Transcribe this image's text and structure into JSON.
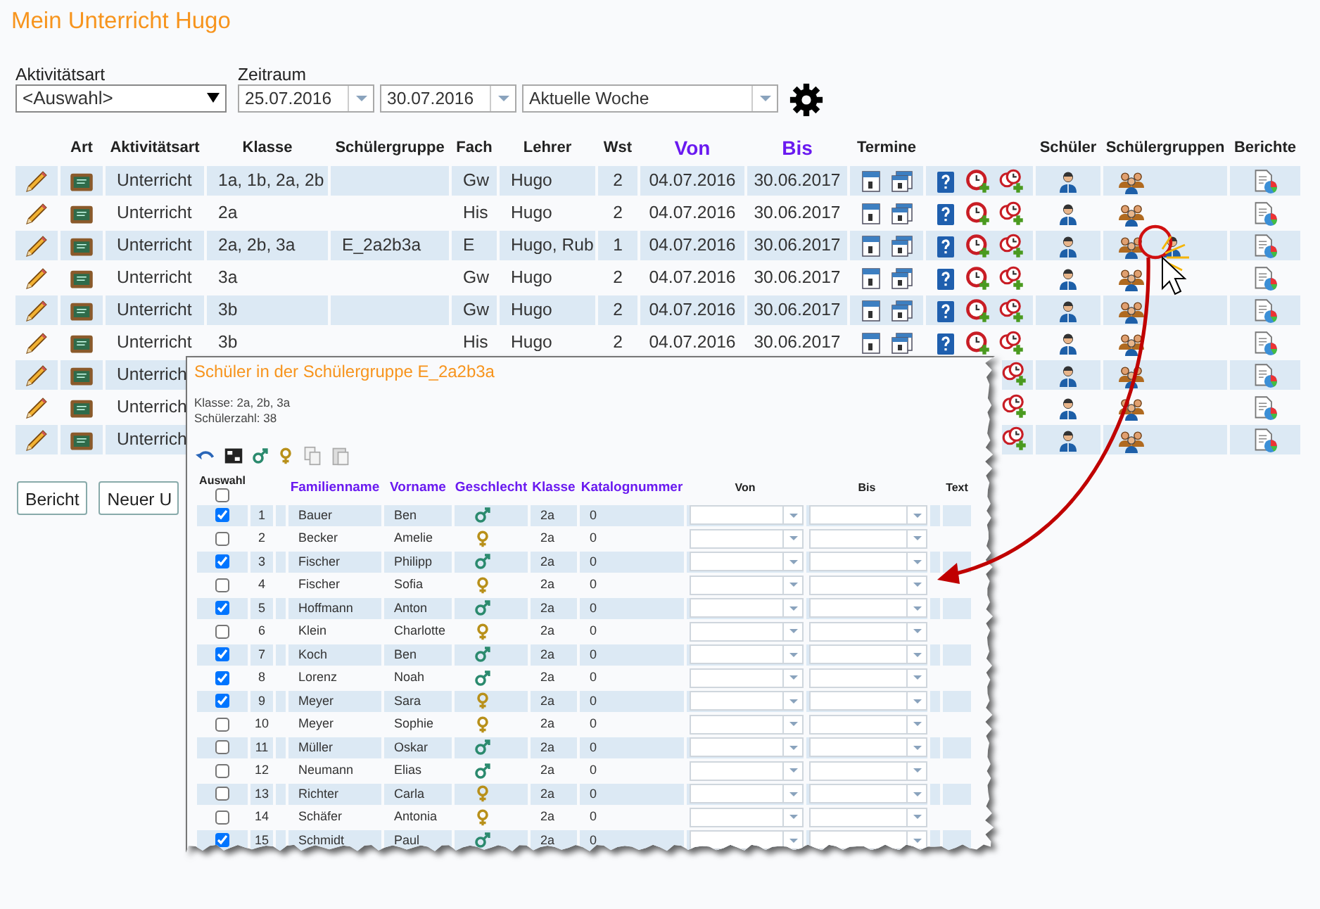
{
  "page_title": "Mein Unterricht Hugo",
  "filters": {
    "aktivitaetsart": {
      "label": "Aktivitätsart",
      "value": "<Auswahl>"
    },
    "zeitraum": {
      "label": "Zeitraum",
      "from": "25.07.2016",
      "to": "30.07.2016",
      "preset": "Aktuelle Woche"
    }
  },
  "table": {
    "columns": [
      {
        "label": "Art",
        "sortable": false
      },
      {
        "label": "Aktivitätsart",
        "sortable": false
      },
      {
        "label": "Klasse",
        "sortable": false
      },
      {
        "label": "Schülergruppe",
        "sortable": false
      },
      {
        "label": "Fach",
        "sortable": false
      },
      {
        "label": "Lehrer",
        "sortable": false
      },
      {
        "label": "Wst",
        "sortable": false
      },
      {
        "label": "Von",
        "sortable": true
      },
      {
        "label": "Bis",
        "sortable": true
      },
      {
        "label": "Termine",
        "sortable": false
      },
      {
        "label": "Schüler",
        "sortable": false
      },
      {
        "label": "Schülergruppen",
        "sortable": false
      },
      {
        "label": "Berichte",
        "sortable": false
      }
    ],
    "rows": [
      {
        "aktivitaetsart": "Unterricht",
        "klasse": "1a, 1b, 2a, 2b",
        "schuelergruppe": "",
        "fach": "Gw",
        "lehrer": "Hugo",
        "wst": "2",
        "von": "04.07.2016",
        "bis": "30.06.2017",
        "covered": false,
        "group_member": false,
        "callout": false
      },
      {
        "aktivitaetsart": "Unterricht",
        "klasse": "2a",
        "schuelergruppe": "",
        "fach": "His",
        "lehrer": "Hugo",
        "wst": "2",
        "von": "04.07.2016",
        "bis": "30.06.2017",
        "covered": false,
        "group_member": false,
        "callout": false
      },
      {
        "aktivitaetsart": "Unterricht",
        "klasse": "2a, 2b, 3a",
        "schuelergruppe": "E_2a2b3a",
        "fach": "E",
        "lehrer": "Hugo, Rub",
        "wst": "1",
        "von": "04.07.2016",
        "bis": "30.06.2017",
        "covered": false,
        "group_member": true,
        "callout": true
      },
      {
        "aktivitaetsart": "Unterricht",
        "klasse": "3a",
        "schuelergruppe": "",
        "fach": "Gw",
        "lehrer": "Hugo",
        "wst": "2",
        "von": "04.07.2016",
        "bis": "30.06.2017",
        "covered": false,
        "group_member": false,
        "callout": false
      },
      {
        "aktivitaetsart": "Unterricht",
        "klasse": "3b",
        "schuelergruppe": "",
        "fach": "Gw",
        "lehrer": "Hugo",
        "wst": "2",
        "von": "04.07.2016",
        "bis": "30.06.2017",
        "covered": false,
        "group_member": false,
        "callout": false
      },
      {
        "aktivitaetsart": "Unterricht",
        "klasse": "3b",
        "schuelergruppe": "",
        "fach": "His",
        "lehrer": "Hugo",
        "wst": "2",
        "von": "04.07.2016",
        "bis": "30.06.2017",
        "covered": false,
        "group_member": false,
        "callout": false
      },
      {
        "aktivitaetsart": "Unterrich",
        "covered": true,
        "group_member": false,
        "callout": false
      },
      {
        "aktivitaetsart": "Unterrich",
        "covered": true,
        "group_member": false,
        "callout": false
      },
      {
        "aktivitaetsart": "Unterrich",
        "covered": true,
        "group_member": false,
        "callout": false
      }
    ]
  },
  "buttons": [
    "Bericht",
    "Neuer U"
  ],
  "popup": {
    "title": "Schüler in der Schülergruppe E_2a2b3a",
    "info": [
      "Klasse: 2a, 2b, 3a",
      "Schülerzahl: 38"
    ],
    "select_all": {
      "label": "Auswahl",
      "checked": false
    },
    "columns": [
      {
        "label": "Familienname",
        "sortable": true
      },
      {
        "label": "Vorname",
        "sortable": true
      },
      {
        "label": "Geschlecht",
        "sortable": true
      },
      {
        "label": "Klasse",
        "sortable": true
      },
      {
        "label": "Katalognummer",
        "sortable": true
      },
      {
        "label": "Von",
        "sortable": false
      },
      {
        "label": "Bis",
        "sortable": false
      },
      {
        "label": "Text",
        "sortable": false
      }
    ],
    "rows": [
      {
        "checked": true,
        "nr": "1",
        "familienname": "Bauer",
        "vorname": "Ben",
        "kind": "male",
        "klasse": "2a",
        "katalognummer": "0"
      },
      {
        "checked": false,
        "nr": "2",
        "familienname": "Becker",
        "vorname": "Amelie",
        "kind": "female",
        "klasse": "2a",
        "katalognummer": "0"
      },
      {
        "checked": true,
        "nr": "3",
        "familienname": "Fischer",
        "vorname": "Philipp",
        "kind": "male",
        "klasse": "2a",
        "katalognummer": "0"
      },
      {
        "checked": false,
        "nr": "4",
        "familienname": "Fischer",
        "vorname": "Sofia",
        "kind": "female",
        "klasse": "2a",
        "katalognummer": "0"
      },
      {
        "checked": true,
        "nr": "5",
        "familienname": "Hoffmann",
        "vorname": "Anton",
        "kind": "male",
        "klasse": "2a",
        "katalognummer": "0"
      },
      {
        "checked": false,
        "nr": "6",
        "familienname": "Klein",
        "vorname": "Charlotte",
        "kind": "female",
        "klasse": "2a",
        "katalognummer": "0"
      },
      {
        "checked": true,
        "nr": "7",
        "familienname": "Koch",
        "vorname": "Ben",
        "kind": "male",
        "klasse": "2a",
        "katalognummer": "0"
      },
      {
        "checked": true,
        "nr": "8",
        "familienname": "Lorenz",
        "vorname": "Noah",
        "kind": "male",
        "klasse": "2a",
        "katalognummer": "0"
      },
      {
        "checked": true,
        "nr": "9",
        "familienname": "Meyer",
        "vorname": "Sara",
        "kind": "female",
        "klasse": "2a",
        "katalognummer": "0"
      },
      {
        "checked": false,
        "nr": "10",
        "familienname": "Meyer",
        "vorname": "Sophie",
        "kind": "female",
        "klasse": "2a",
        "katalognummer": "0"
      },
      {
        "checked": false,
        "nr": "11",
        "familienname": "Müller",
        "vorname": "Oskar",
        "kind": "male",
        "klasse": "2a",
        "katalognummer": "0"
      },
      {
        "checked": false,
        "nr": "12",
        "familienname": "Neumann",
        "vorname": "Elias",
        "kind": "male",
        "klasse": "2a",
        "katalognummer": "0"
      },
      {
        "checked": false,
        "nr": "13",
        "familienname": "Richter",
        "vorname": "Carla",
        "kind": "female",
        "klasse": "2a",
        "katalognummer": "0"
      },
      {
        "checked": false,
        "nr": "14",
        "familienname": "Schäfer",
        "vorname": "Antonia",
        "kind": "female",
        "klasse": "2a",
        "katalognummer": "0"
      },
      {
        "checked": true,
        "nr": "15",
        "familienname": "Schmidt",
        "vorname": "Paul",
        "kind": "male",
        "klasse": "2a",
        "katalognummer": "0"
      }
    ]
  }
}
